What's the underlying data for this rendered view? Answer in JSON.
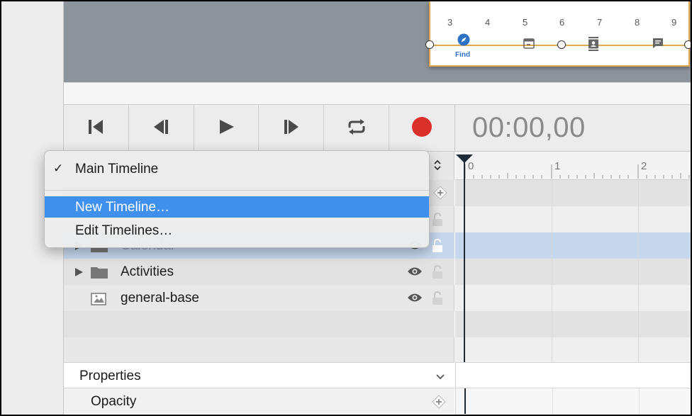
{
  "canvas": {
    "phone_ruler": [
      "3",
      "4",
      "5",
      "6",
      "7",
      "8",
      "9"
    ],
    "tabs": [
      {
        "icon": "compass-icon",
        "label": "Find",
        "active": true
      },
      {
        "icon": "calendar-icon"
      },
      {
        "icon": "contacts-icon"
      },
      {
        "icon": "message-icon"
      }
    ],
    "accent": "#e0a84f",
    "tab_active_color": "#2d72c4"
  },
  "toolbar": {
    "buttons": [
      "go-to-start-icon",
      "step-back-icon",
      "play-icon",
      "step-forward-icon",
      "loop-icon",
      "record-icon"
    ],
    "record_color": "#d9302c"
  },
  "timecode": "00:00,00",
  "timeline_ruler": [
    "0",
    "1",
    "2"
  ],
  "timeline_menu": {
    "items": [
      {
        "label": "Main Timeline",
        "checked": true
      },
      {
        "label": "New Timeline…",
        "highlighted": true
      },
      {
        "label": "Edit Timelines…"
      }
    ],
    "highlight_color": "#3f8fed"
  },
  "layers": [
    {
      "name": "Calendar",
      "type": "folder",
      "selected": true
    },
    {
      "name": "Activities",
      "type": "folder"
    },
    {
      "name": "general-base",
      "type": "image"
    }
  ],
  "properties": {
    "header": "Properties",
    "rows": [
      "Opacity"
    ]
  }
}
